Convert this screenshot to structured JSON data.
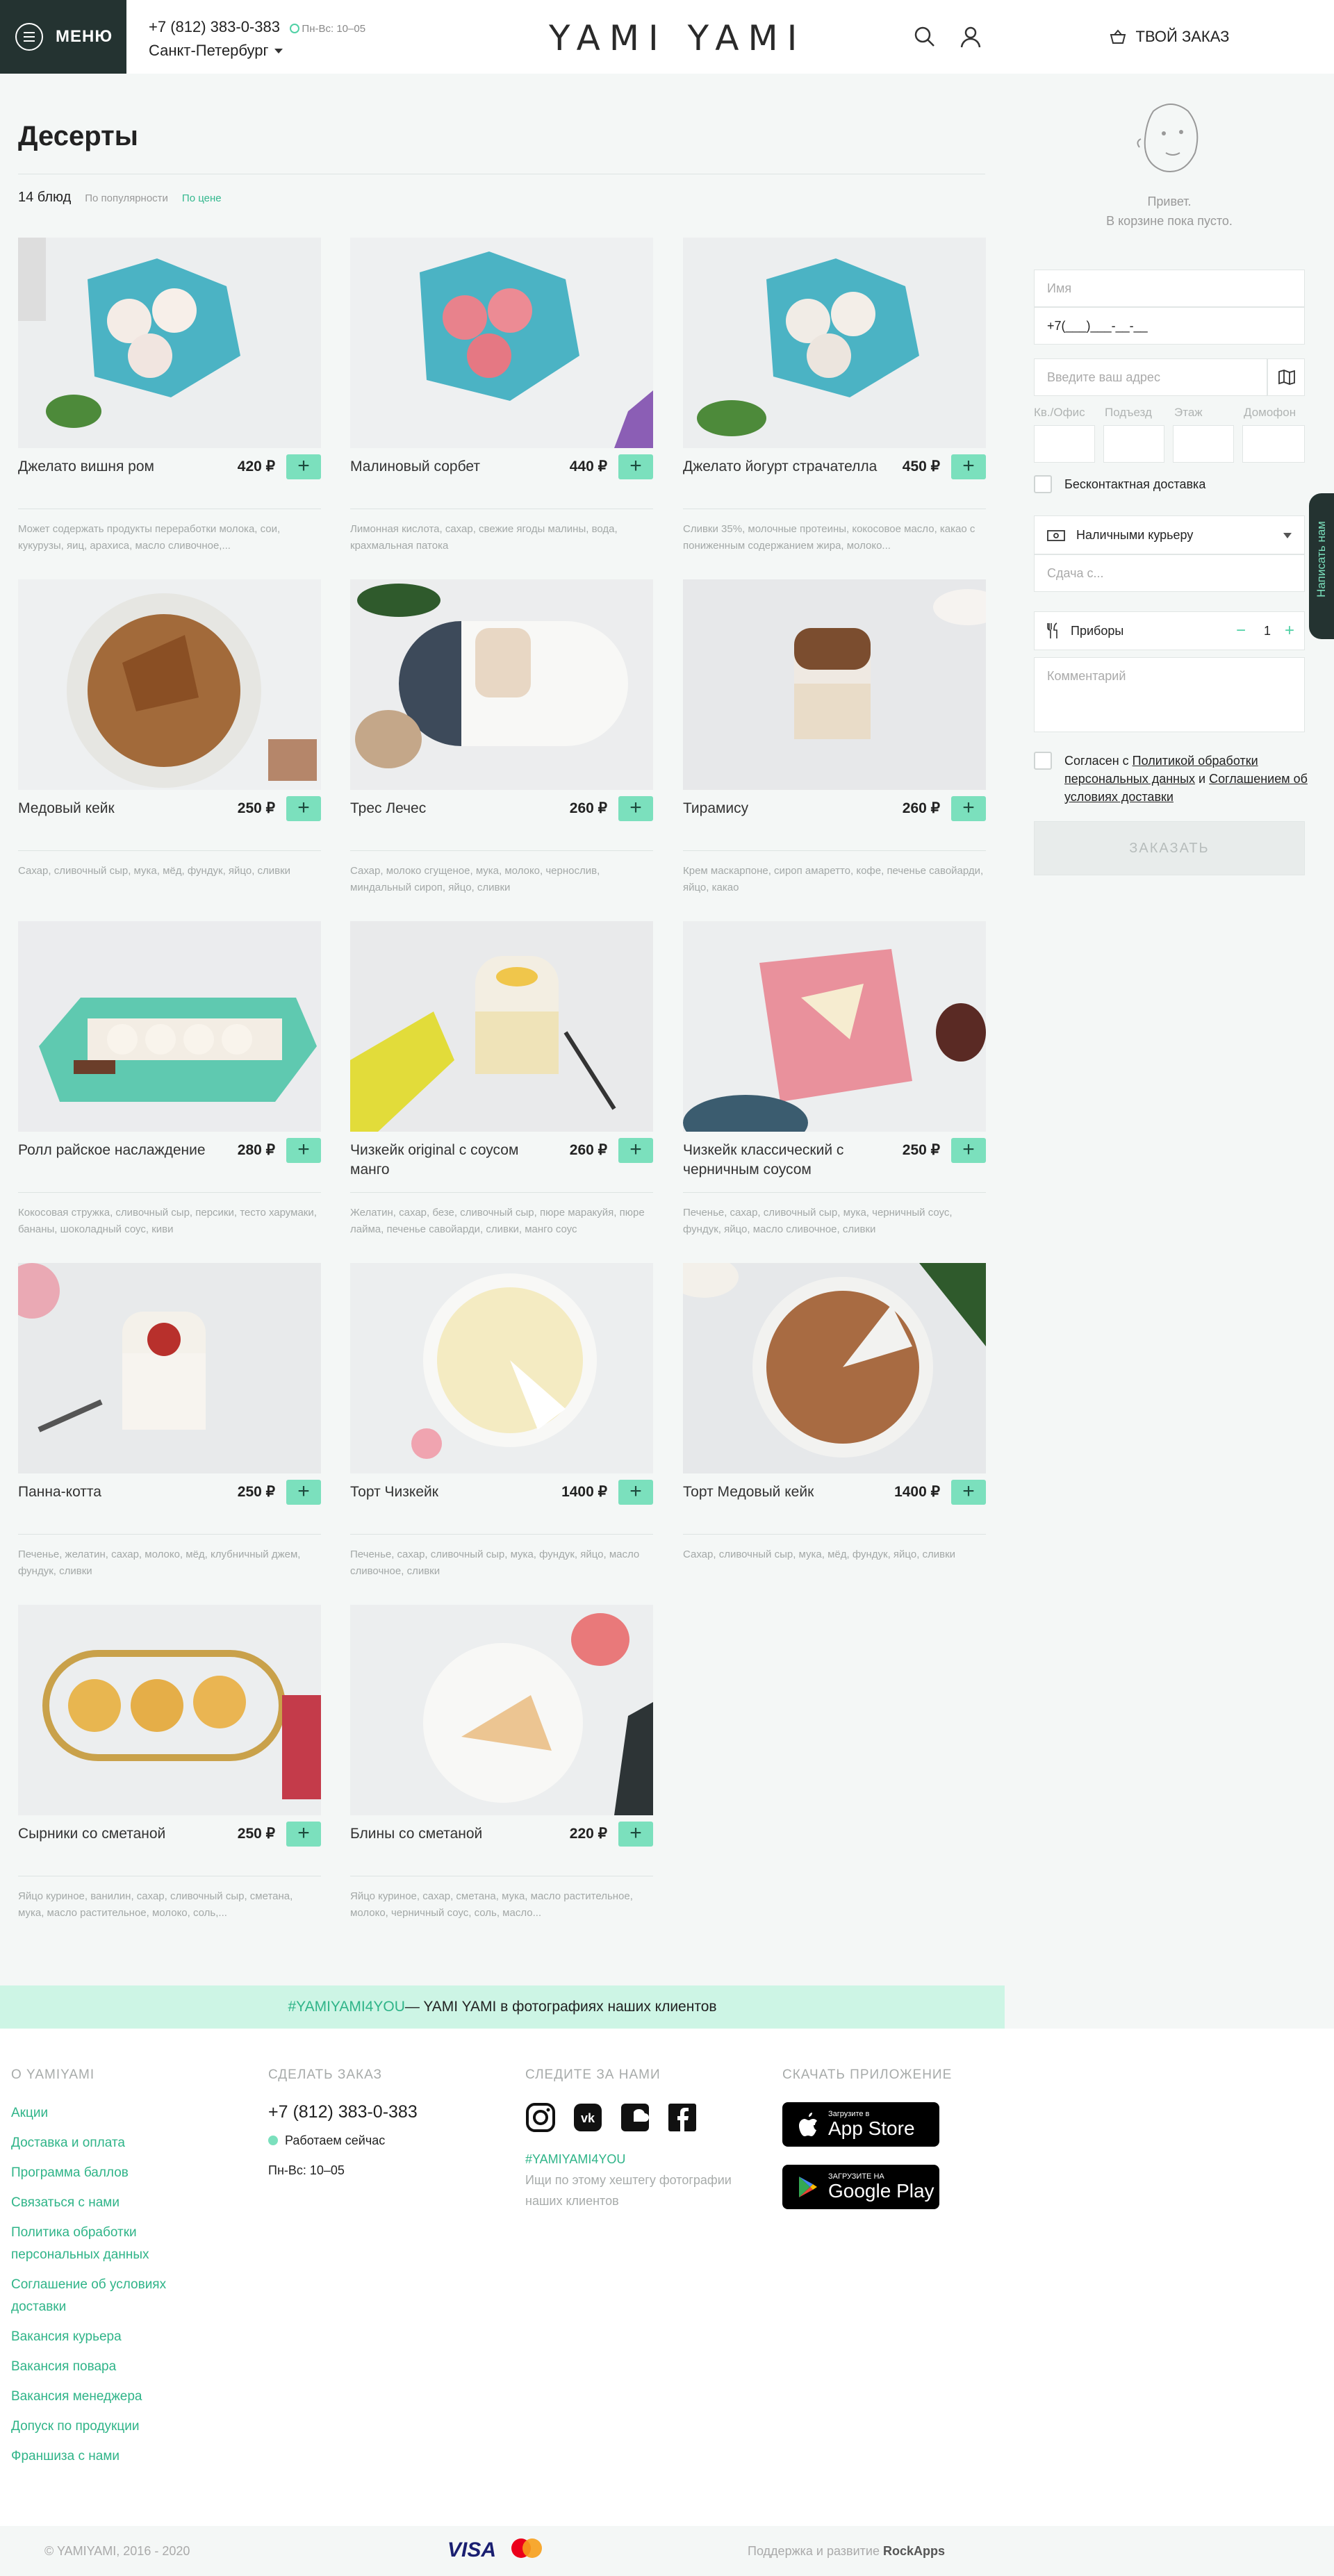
{
  "header": {
    "menu_label": "МЕНЮ",
    "phone": "+7 (812) 383-0-383",
    "hours": "Пн-Вс: 10–05",
    "city": "Санкт-Петербург",
    "logo": "YAMI YAMI"
  },
  "page": {
    "title": "Десерты",
    "count": "14 блюд",
    "sort_popular": "По популярности",
    "sort_price": "По цене"
  },
  "products": [
    {
      "name": "Джелато вишня ром",
      "price": "420 ₽",
      "desc": "Может содержать продукты переработки молока, сои, кукурузы, яиц, арахиса, масло сливочное,..."
    },
    {
      "name": "Малиновый сорбет",
      "price": "440 ₽",
      "desc": "Лимонная кислота, сахар, свежие ягоды малины, вода, крахмальная патока"
    },
    {
      "name": "Джелато йогурт страчателла",
      "price": "450 ₽",
      "desc": "Сливки 35%, молочные протеины, кокосовое масло, какао с пониженным содержанием жира, молоко..."
    },
    {
      "name": "Медовый кейк",
      "price": "250 ₽",
      "desc": "Сахар, сливочный сыр, мука, мёд, фундук, яйцо, сливки"
    },
    {
      "name": "Трес Лечес",
      "price": "260 ₽",
      "desc": "Сахар, молоко сгущеное, мука, молоко, чернослив, миндальный сироп, яйцо, сливки"
    },
    {
      "name": "Тирамису",
      "price": "260 ₽",
      "desc": "Крем маскарпоне, сироп амаретто, кофе, печенье савойарди, яйцо, какао"
    },
    {
      "name": "Ролл райское наслаждение",
      "price": "280 ₽",
      "desc": "Кокосовая стружка, сливочный сыр, персики, тесто харумаки, бананы, шоколадный соус, киви"
    },
    {
      "name": "Чизкейк original с соусом манго",
      "price": "260 ₽",
      "desc": "Желатин, сахар, безе, сливочный сыр, пюре маракуйя, пюре лайма, печенье савойарди, сливки, манго соус"
    },
    {
      "name": "Чизкейк классический с черничным соусом",
      "price": "250 ₽",
      "desc": "Печенье, сахар, сливочный сыр, мука, черничный соус, фундук, яйцо, масло сливочное, сливки"
    },
    {
      "name": "Панна-котта",
      "price": "250 ₽",
      "desc": "Печенье, желатин, сахар, молоко, мёд, клубничный джем, фундук, сливки"
    },
    {
      "name": "Торт Чизкейк",
      "price": "1400 ₽",
      "desc": "Печенье, сахар, сливочный сыр, мука, фундук, яйцо, масло сливочное, сливки"
    },
    {
      "name": "Торт Медовый кейк",
      "price": "1400 ₽",
      "desc": "Сахар, сливочный сыр, мука, мёд, фундук, яйцо, сливки"
    },
    {
      "name": "Сырники со сметаной",
      "price": "250 ₽",
      "desc": "Яйцо куриное, ванилин, сахар, сливочный сыр, сметана, мука, масло растительное, молоко, соль,..."
    },
    {
      "name": "Блины со сметаной",
      "price": "220 ₽",
      "desc": "Яйцо куриное, сахар, сметана, мука, масло растительное, молоко, черничный соус, соль, масло..."
    }
  ],
  "cart": {
    "title": "ТВОЙ ЗАКАЗ",
    "empty_line1": "Привет.",
    "empty_line2": "В корзине пока пусто.",
    "name_placeholder": "Имя",
    "phone_value": "+7(___)___-__-__",
    "address_placeholder": "Введите ваш адрес",
    "apt": "Кв./Офис",
    "entrance": "Подъезд",
    "floor": "Этаж",
    "intercom": "Домофон",
    "contactless": "Бесконтактная доставка",
    "payment": "Наличными курьеру",
    "change_placeholder": "Сдача с...",
    "cutlery": "Приборы",
    "cutlery_count": "1",
    "comment_placeholder": "Комментарий",
    "agree_prefix": "Согласен с ",
    "agree_link1": "Политикой обработки персональных данных",
    "agree_and": " и ",
    "agree_link2": "Соглашением об условиях доставки",
    "order_button": "ЗАКАЗАТЬ",
    "side_tab": "Написать нам"
  },
  "banner": {
    "tag": "#YAMIYAMI4YOU",
    "text": " — YAMI YAMI в фотографиях наших клиентов"
  },
  "footer": {
    "about_head": "О YAMIYAMI",
    "about_links": [
      "Акции",
      "Доставка и оплата",
      "Программа баллов",
      "Связаться с нами",
      "Политика обработки персональных данных",
      "Соглашение об условиях доставки",
      "Вакансия курьера",
      "Вакансия повара",
      "Вакансия менеджера",
      "Допуск по продукции",
      "Франшиза с нами"
    ],
    "order_head": "СДЕЛАТЬ ЗАКАЗ",
    "phone": "+7 (812) 383-0-383",
    "open_now": "Работаем сейчас",
    "hours": "Пн-Вс: 10–05",
    "follow_head": "СЛЕДИТЕ ЗА НАМИ",
    "hashtag": "#YAMIYAMI4YOU",
    "hashtag_note": "Ищи по этому хештегу фотографии наших клиентов",
    "app_head": "СКАЧАТЬ ПРИЛОЖЕНИЕ",
    "appstore_small": "Загрузите в",
    "appstore_big": "App Store",
    "gplay_small": "ЗАГРУЗИТЕ НА",
    "gplay_big": "Google Play",
    "copyright": "© YAMIYAMI, 2016 - 2020",
    "visa": "VISA",
    "support_prefix": "Поддержка и развитие ",
    "support_name": "RockApps"
  },
  "colors": {
    "accent": "#7be0bd",
    "accent_text": "#2fb488",
    "dark": "#243331",
    "banner": "#cdf5e5"
  }
}
